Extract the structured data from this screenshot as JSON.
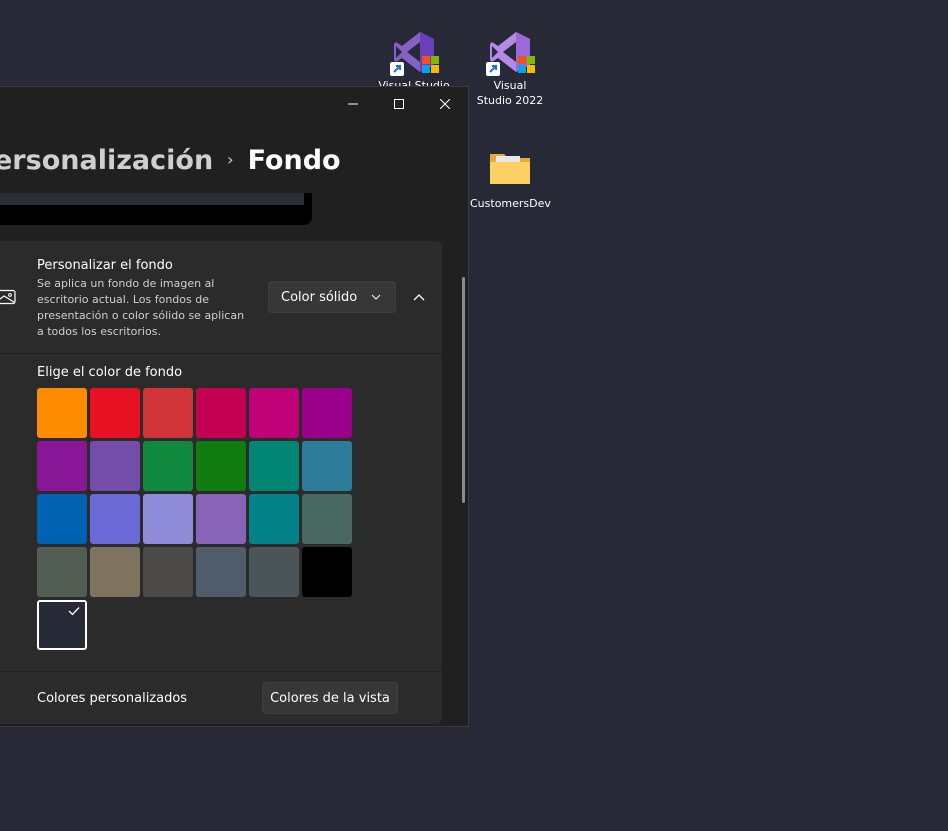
{
  "desktop": {
    "icons": [
      {
        "label": "Visual Studio",
        "name": "visual-studio-icon"
      },
      {
        "label": "Visual Studio 2022",
        "name": "visual-studio-2022-icon"
      },
      {
        "label": "CustomersDev",
        "name": "customersdev-folder-icon"
      }
    ]
  },
  "window": {
    "breadcrumb": {
      "parent": "ersonalización",
      "separator": "›",
      "current": "Fondo"
    },
    "personalize": {
      "title": "Personalizar el fondo",
      "description": "Se aplica un fondo de imagen al escritorio actual. Los fondos de presentación o color sólido se aplican a todos los escritorios.",
      "dropdown_value": "Color sólido"
    },
    "colors": {
      "heading": "Elige el color de fondo",
      "swatches": [
        "#ff8c00",
        "#e81123",
        "#d13438",
        "#c30052",
        "#bf0077",
        "#9a0089",
        "#881798",
        "#744da9",
        "#10893e",
        "#107c10",
        "#018574",
        "#2d7d9a",
        "#0063b1",
        "#6b69d6",
        "#8e8cd8",
        "#8764b8",
        "#038387",
        "#486860",
        "#525e54",
        "#7e735f",
        "#4c4a48",
        "#515c6b",
        "#4a5459",
        "#000000",
        "#262936"
      ],
      "selected_index": 24
    },
    "custom": {
      "label": "Colores personalizados",
      "button": "Colores de la vista"
    }
  }
}
